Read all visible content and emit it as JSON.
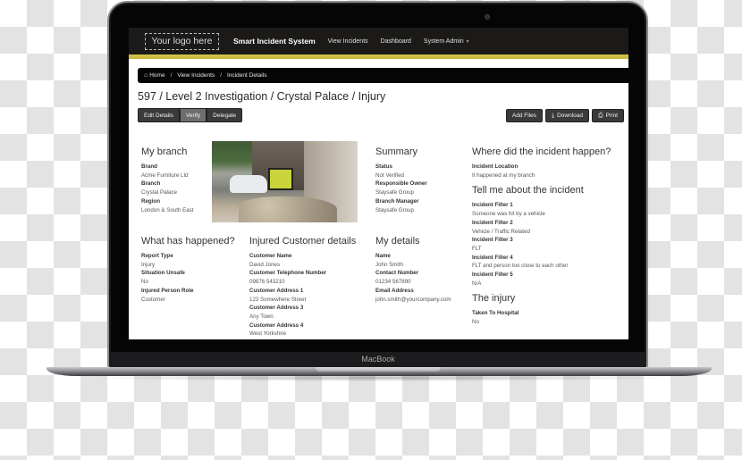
{
  "device": {
    "label": "MacBook"
  },
  "navbar": {
    "logo": "Your logo here",
    "brand": "Smart Incident System",
    "links": [
      "View Incidents",
      "Dashboard",
      "System Admin"
    ],
    "caret": "▾"
  },
  "colors": {
    "accent": "#d3c045",
    "navbar": "#1b1a19",
    "button": "#3a3a3a",
    "button_active": "#6d6d6d"
  },
  "breadcrumb": {
    "items": [
      "Home",
      "View Incidents",
      "Incident Details"
    ],
    "separator": "/"
  },
  "page": {
    "title": "597 / Level 2 Investigation / Crystal Palace / Injury"
  },
  "actions": {
    "left": [
      "Edit Details",
      "Verify",
      "Delegate"
    ],
    "add_files": "Add Files",
    "download": "Download",
    "print": "Print"
  },
  "sections": {
    "my_branch": {
      "title": "My branch",
      "fields": [
        {
          "label": "Brand",
          "value": "Acme Furniture Ltd"
        },
        {
          "label": "Branch",
          "value": "Crystal Palace"
        },
        {
          "label": "Region",
          "value": "London & South East"
        }
      ]
    },
    "summary": {
      "title": "Summary",
      "fields": [
        {
          "label": "Status",
          "value": "Not Verified"
        },
        {
          "label": "Responsible Owner",
          "value": "Staysafe Group"
        },
        {
          "label": "Branch Manager",
          "value": "Staysafe Group"
        }
      ]
    },
    "where": {
      "title": "Where did the incident happen?",
      "fields": [
        {
          "label": "Incident Location",
          "value": "It happened at my branch"
        }
      ]
    },
    "tell_me": {
      "title": "Tell me about the incident",
      "fields": [
        {
          "label": "Incident Filter 1",
          "value": "Someone was hit by a vehicle"
        },
        {
          "label": "Incident Filter 2",
          "value": "Vehicle / Traffic Related"
        },
        {
          "label": "Incident Filter 3",
          "value": "FLT"
        },
        {
          "label": "Incident Filter 4",
          "value": "FLT and person too close to each other"
        },
        {
          "label": "Incident Filter 5",
          "value": "N/A"
        }
      ]
    },
    "injury": {
      "title": "The injury",
      "fields": [
        {
          "label": "Taken To Hospital",
          "value": "No"
        }
      ]
    },
    "what_happened": {
      "title": "What has happened?",
      "fields": [
        {
          "label": "Report Type",
          "value": "Injury"
        },
        {
          "label": "Situation Unsafe",
          "value": "No"
        },
        {
          "label": "Injured Person Role",
          "value": "Customer"
        }
      ]
    },
    "injured_customer": {
      "title": "Injured Customer details",
      "fields": [
        {
          "label": "Customer Name",
          "value": "David Jones"
        },
        {
          "label": "Customer Telephone Number",
          "value": "09876 543210"
        },
        {
          "label": "Customer Address 1",
          "value": "123 Somewhere Street"
        },
        {
          "label": "Customer Address 3",
          "value": "Any Town"
        },
        {
          "label": "Customer Address 4",
          "value": "West Yorkshire"
        }
      ]
    },
    "my_details": {
      "title": "My details",
      "fields": [
        {
          "label": "Name",
          "value": "John Smith"
        },
        {
          "label": "Contact Number",
          "value": "01234 567890"
        },
        {
          "label": "Email Address",
          "value": "john.smith@yourcompany.com"
        }
      ]
    }
  }
}
